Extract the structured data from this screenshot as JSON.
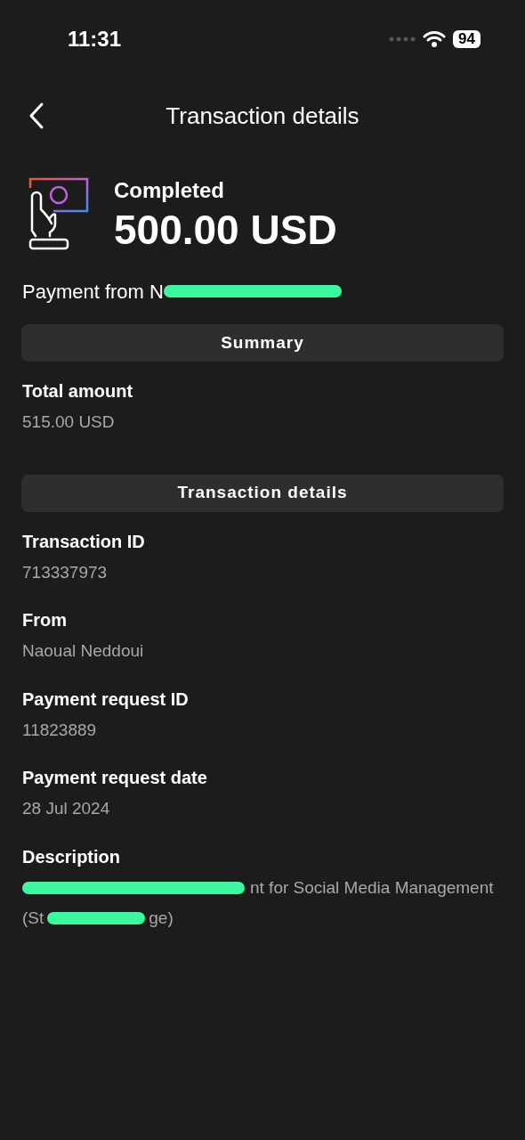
{
  "status_bar": {
    "time": "11:31",
    "battery": "94"
  },
  "header": {
    "title": "Transaction details"
  },
  "summary_top": {
    "status": "Completed",
    "amount": "500.00 USD",
    "payment_from": "Payment from N"
  },
  "sections": [
    {
      "title": "Summary",
      "fields": [
        {
          "label": "Total amount",
          "value": "515.00 USD"
        }
      ]
    },
    {
      "title": "Transaction details",
      "fields": [
        {
          "label": "Transaction ID",
          "value": "713337973"
        },
        {
          "label": "From",
          "value": "Naoual Neddoui"
        },
        {
          "label": "Payment request ID",
          "value": "11823889"
        },
        {
          "label": "Payment request date",
          "value": "28 Jul 2024"
        },
        {
          "label": "Description",
          "value_parts": [
            "nt for Social Media Management",
            "(St",
            "ge)"
          ]
        }
      ]
    }
  ]
}
